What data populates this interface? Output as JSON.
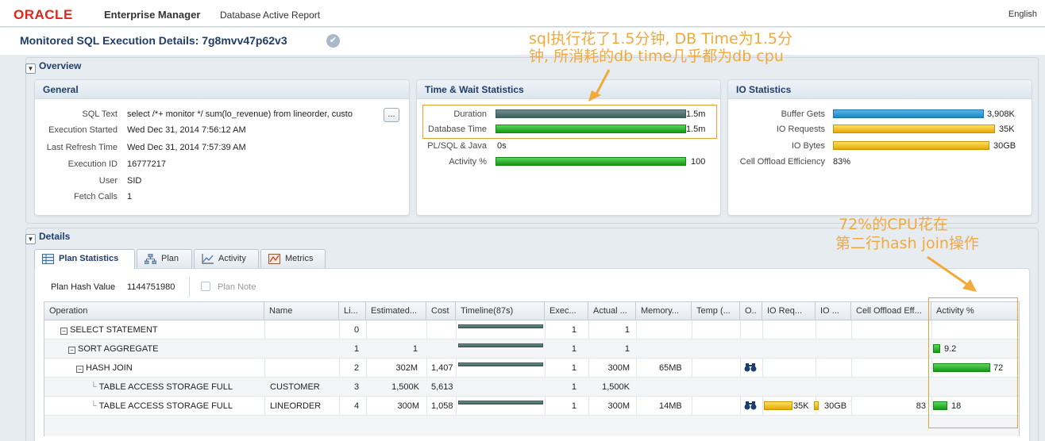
{
  "header": {
    "logo": "ORACLE",
    "product": "Enterprise Manager",
    "subtitle": "Database Active Report",
    "language": "English"
  },
  "page": {
    "title": "Monitored SQL Execution Details: 7g8mvv47p62v3"
  },
  "overview": {
    "label": "Overview",
    "general": {
      "title": "General",
      "sql_text_label": "SQL Text",
      "sql_text": "select /*+ monitor */ sum(lo_revenue) from lineorder, custo",
      "ellipsis": "...",
      "exec_started_label": "Execution Started",
      "exec_started": "Wed Dec 31, 2014 7:56:12 AM",
      "last_refresh_label": "Last Refresh Time",
      "last_refresh": "Wed Dec 31, 2014 7:57:39 AM",
      "exec_id_label": "Execution ID",
      "exec_id": "16777217",
      "user_label": "User",
      "user": "SID",
      "fetch_calls_label": "Fetch Calls",
      "fetch_calls": "1"
    },
    "time_wait": {
      "title": "Time & Wait Statistics",
      "duration_label": "Duration",
      "duration": "1.5m",
      "db_time_label": "Database Time",
      "db_time": "1.5m",
      "plsql_label": "PL/SQL & Java",
      "plsql": "0s",
      "activity_label": "Activity %",
      "activity": "100"
    },
    "io": {
      "title": "IO Statistics",
      "buffer_gets_label": "Buffer Gets",
      "buffer_gets": "3,908K",
      "io_requests_label": "IO Requests",
      "io_requests": "35K",
      "io_bytes_label": "IO Bytes",
      "io_bytes": "30GB",
      "cell_offload_label": "Cell Offload Efficiency",
      "cell_offload": "83%"
    }
  },
  "details": {
    "label": "Details",
    "tabs": [
      "Plan Statistics",
      "Plan",
      "Activity",
      "Metrics"
    ],
    "plan_hash_label": "Plan Hash Value",
    "plan_hash": "1144751980",
    "plan_note": "Plan Note",
    "columns": [
      "Operation",
      "Name",
      "Li...",
      "Estimated...",
      "Cost",
      "Timeline(87s)",
      "Exec...",
      "Actual ...",
      "Memory...",
      "Temp (...",
      "O..",
      "IO Req...",
      "IO ...",
      "Cell Offload Eff...",
      "Activity %"
    ],
    "rows": [
      {
        "op": "SELECT STATEMENT",
        "name": "",
        "line": "0",
        "est": "",
        "cost": "",
        "exec": "1",
        "actual": "1",
        "mem": "",
        "io_req": "",
        "io_bytes": "",
        "cell": "",
        "activity": ""
      },
      {
        "op": "SORT AGGREGATE",
        "name": "",
        "line": "1",
        "est": "1",
        "cost": "",
        "exec": "1",
        "actual": "1",
        "mem": "",
        "io_req": "",
        "io_bytes": "",
        "cell": "",
        "activity": "9.2"
      },
      {
        "op": "HASH JOIN",
        "name": "",
        "line": "2",
        "est": "302M",
        "cost": "1,407",
        "exec": "1",
        "actual": "300M",
        "mem": "65MB",
        "io_req": "",
        "io_bytes": "",
        "cell": "",
        "activity": "72"
      },
      {
        "op": "TABLE ACCESS STORAGE FULL",
        "name": "CUSTOMER",
        "line": "3",
        "est": "1,500K",
        "cost": "5,613",
        "exec": "1",
        "actual": "1,500K",
        "mem": "",
        "io_req": "",
        "io_bytes": "",
        "cell": "",
        "activity": ""
      },
      {
        "op": "TABLE ACCESS STORAGE FULL",
        "name": "LINEORDER",
        "line": "4",
        "est": "300M",
        "cost": "1,058",
        "exec": "1",
        "actual": "300M",
        "mem": "14MB",
        "io_req": "35K",
        "io_bytes": "30GB",
        "cell": "83",
        "activity": "18"
      }
    ]
  },
  "annotations": {
    "top_line1": "sql执行花了1.5分钟, DB Time为1.5分",
    "top_line2": "钟, 所消耗的db time几乎都为db cpu",
    "right_line1": "72%的CPU花在",
    "right_line2": "第二行hash join操作"
  },
  "colors": {
    "brand_red": "#e1251b",
    "title_blue": "#1f3d6d",
    "bar_green": "#139a13",
    "bar_blue": "#1e86c4",
    "bar_yellow": "#e4a800",
    "annotation_orange": "#f2a93b"
  },
  "bar_fractions": {
    "duration": 1.0,
    "db_time": 1.0,
    "activity": 1.0,
    "buffer_gets": 1.0,
    "io_requests": 1.0,
    "io_bytes": 1.0,
    "row_activity": [
      0,
      0.092,
      0.72,
      0,
      0.18
    ]
  }
}
